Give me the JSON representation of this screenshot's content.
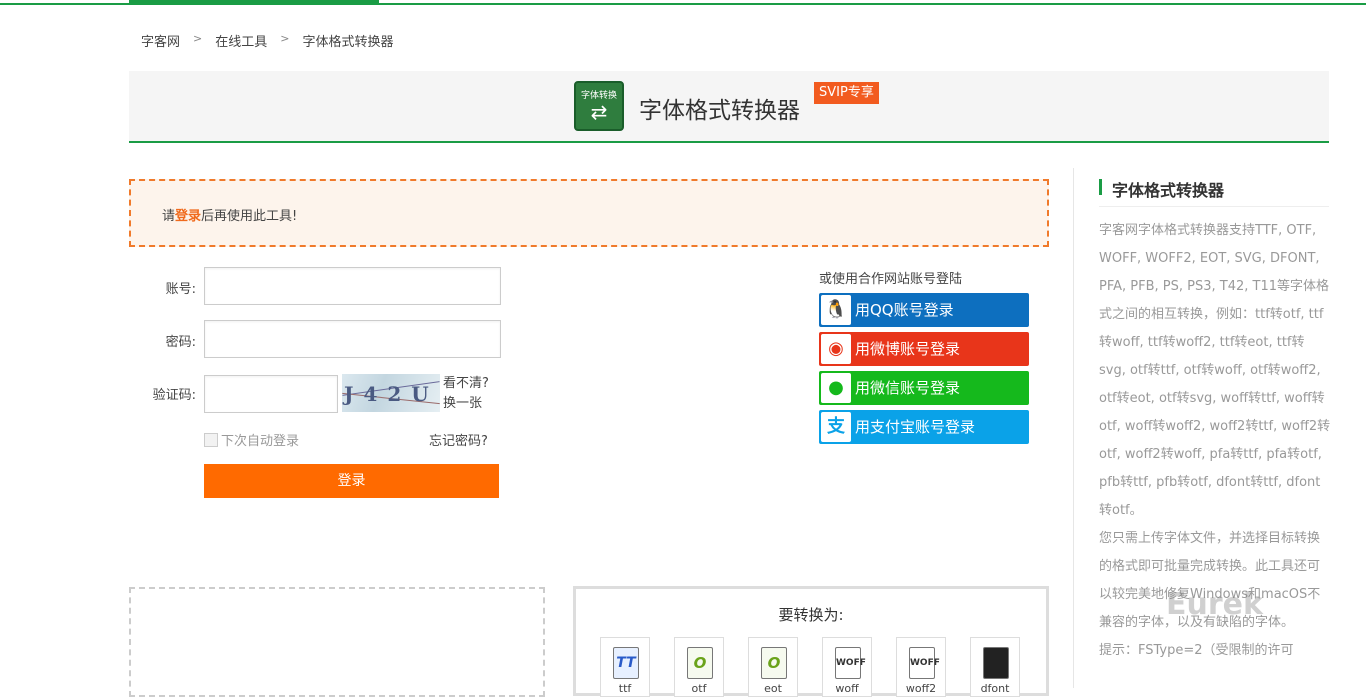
{
  "breadcrumb": {
    "home": "字客网",
    "tools": "在线工具",
    "current": "字体格式转换器",
    "sep": ">"
  },
  "banner": {
    "logo_text": "字体转换",
    "title": "字体格式转换器",
    "badge": "SVIP专享"
  },
  "notice": {
    "prefix": "请",
    "link": "登录",
    "suffix": "后再使用此工具!"
  },
  "login": {
    "account_label": "账号:",
    "password_label": "密码:",
    "captcha_label": "验证码:",
    "captcha_value": "J42U",
    "refresh_line1": "看不清?",
    "refresh_line2": "换一张",
    "remember": "下次自动登录",
    "forgot": "忘记密码?",
    "submit": "登录"
  },
  "partners": {
    "title": "或使用合作网站账号登陆",
    "qq": "用QQ账号登录",
    "weibo": "用微博账号登录",
    "wechat": "用微信账号登录",
    "alipay": "用支付宝账号登录"
  },
  "convert": {
    "title": "要转换为:",
    "formats": [
      "ttf",
      "otf",
      "eot",
      "woff",
      "woff2",
      "dfont"
    ],
    "icon_texts": [
      "TT",
      "O",
      "O",
      "WOFF",
      "WOFF",
      ""
    ]
  },
  "sidebar": {
    "title": "字体格式转换器",
    "para1": "字客网字体格式转换器支持TTF, OTF, WOFF, WOFF2, EOT, SVG, DFONT, PFA, PFB, PS, PS3, T42, T11等字体格式之间的相互转换，例如：ttf转otf, ttf转woff, ttf转woff2, ttf转eot, ttf转svg, otf转ttf, otf转woff, otf转woff2, otf转eot, otf转svg, woff转ttf, woff转otf, woff转woff2, woff2转ttf, woff2转otf, woff2转woff, pfa转ttf, pfa转otf, pfb转ttf, pfb转otf, dfont转ttf, dfont转otf。",
    "para2": "您只需上传字体文件，并选择目标转换的格式即可批量完成转换。此工具还可以较完美地修复Windows和macOS不兼容的字体，以及有缺陷的字体。",
    "para3": "提示：FSType=2（受限制的许可"
  },
  "watermark": "Eurek"
}
